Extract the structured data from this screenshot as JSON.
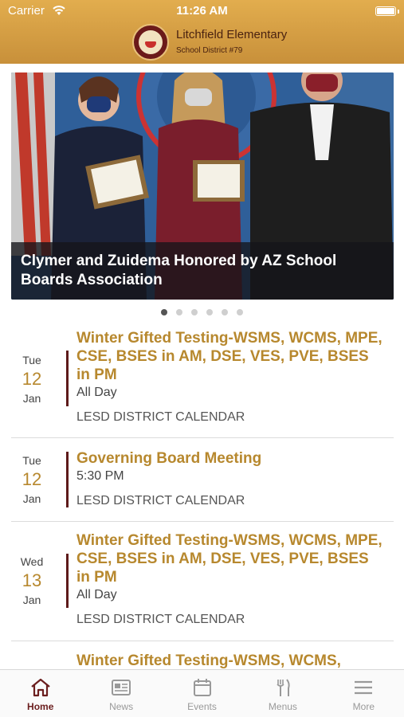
{
  "status_bar": {
    "carrier": "Carrier",
    "time": "11:26 AM"
  },
  "header": {
    "school_name": "Litchfield Elementary",
    "district": "School District #79"
  },
  "carousel": {
    "caption": "Clymer and Zuidema Honored by AZ School Boards Association",
    "slide_count": 6,
    "active_slide": 1
  },
  "events": [
    {
      "dow": "Tue",
      "day": "12",
      "month": "Jan",
      "title": "Winter Gifted Testing-WSMS, WCMS, MPE, CSE, BSES in AM, DSE, VES, PVE, BSES in PM",
      "time": "All Day",
      "calendar": "LESD DISTRICT CALENDAR"
    },
    {
      "dow": "Tue",
      "day": "12",
      "month": "Jan",
      "title": "Governing Board Meeting",
      "time": "5:30 PM",
      "calendar": "LESD DISTRICT CALENDAR"
    },
    {
      "dow": "Wed",
      "day": "13",
      "month": "Jan",
      "title": "Winter Gifted Testing-WSMS, WCMS, MPE, CSE, BSES in AM, DSE, VES, PVE, BSES in PM",
      "time": "All Day",
      "calendar": "LESD DISTRICT CALENDAR"
    },
    {
      "title": "Winter Gifted Testing-WSMS, WCMS,"
    }
  ],
  "tabbar": {
    "items": [
      {
        "label": "Home",
        "icon": "home-icon",
        "active": true
      },
      {
        "label": "News",
        "icon": "news-icon",
        "active": false
      },
      {
        "label": "Events",
        "icon": "calendar-icon",
        "active": false
      },
      {
        "label": "Menus",
        "icon": "fork-knife-icon",
        "active": false
      },
      {
        "label": "More",
        "icon": "menu-icon",
        "active": false
      }
    ]
  },
  "colors": {
    "header_gold": "#d9a044",
    "accent_gold": "#b7882e",
    "maroon": "#6b1e1e"
  }
}
